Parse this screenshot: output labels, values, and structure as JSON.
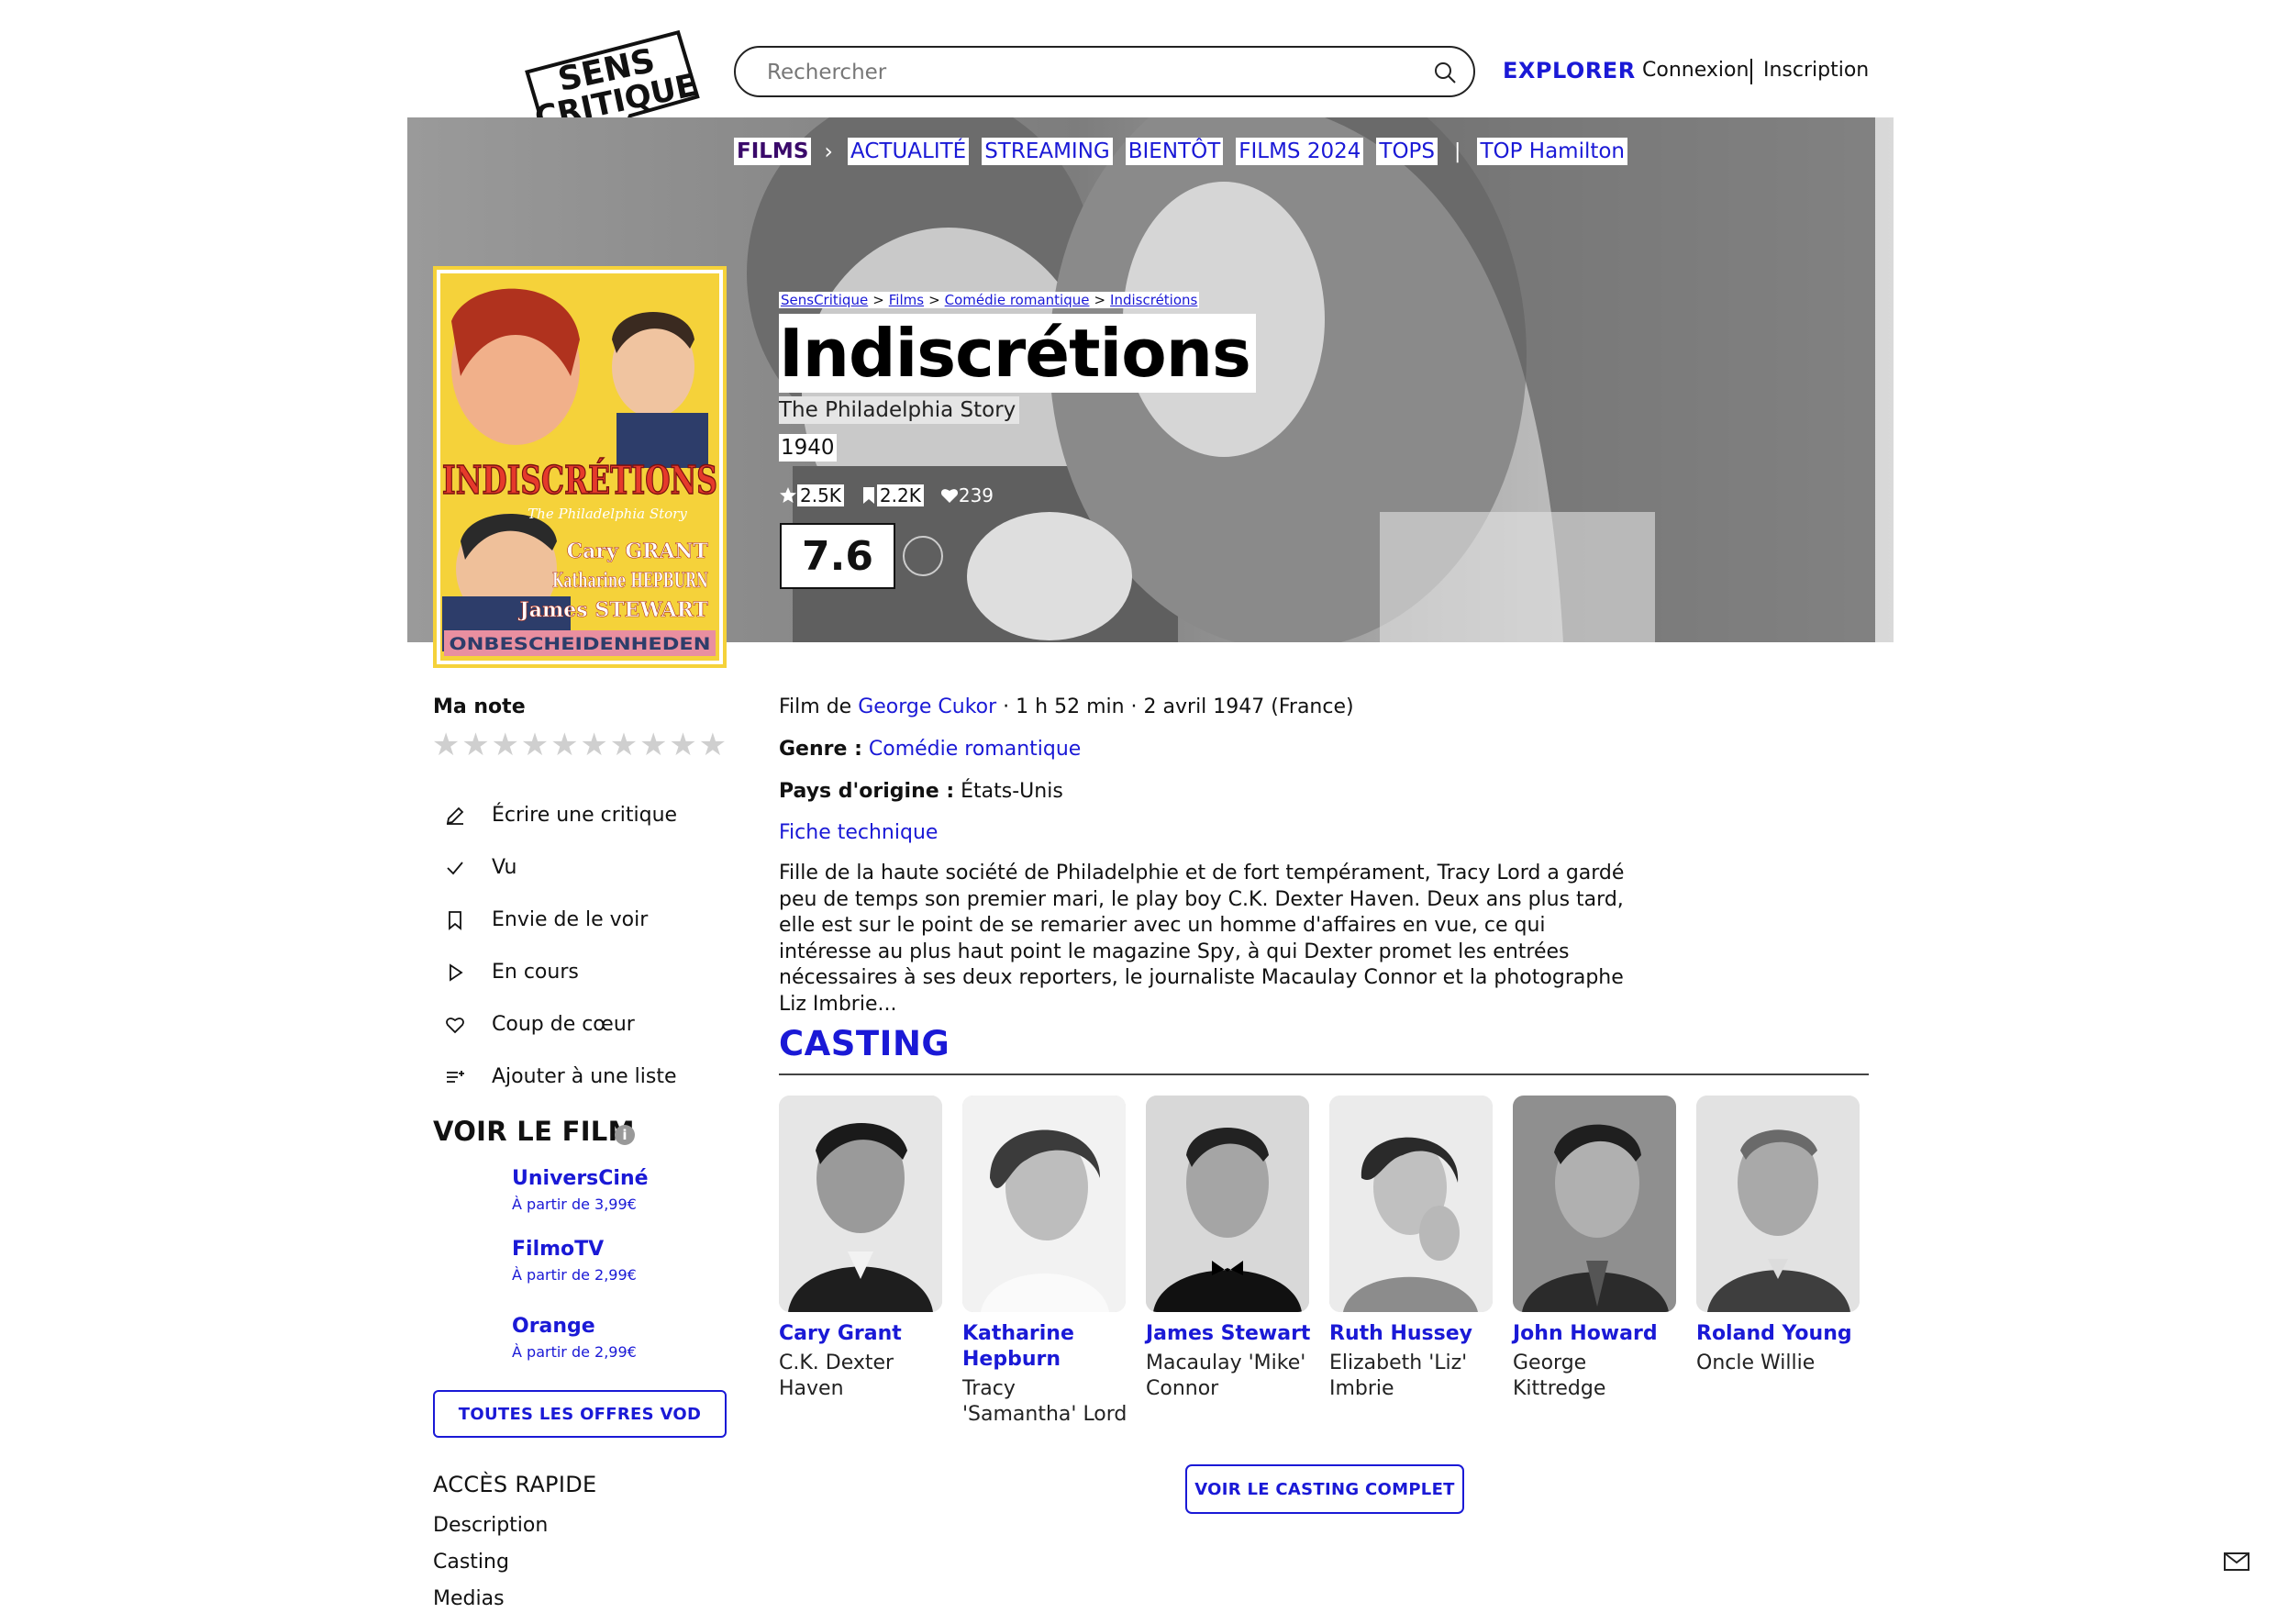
{
  "header": {
    "logo_line1": "SENS",
    "logo_line2": "CRITIQUE",
    "search_placeholder": "Rechercher",
    "explorer": "EXPLORER",
    "login": "Connexion",
    "signup": "Inscription"
  },
  "nav": {
    "films": "FILMS",
    "items": [
      "ACTUALITÉ",
      "STREAMING",
      "BIENTÔT",
      "FILMS 2024",
      "TOPS"
    ],
    "top": "TOP Hamilton"
  },
  "poster": {
    "title": "INDISCRÉTIONS",
    "subtitle": "The Philadelphia Story",
    "actors": [
      "Cary GRANT",
      "Katharine HEPBURN",
      "James STEWART"
    ],
    "banner": "ONBESCHEIDENHEDEN"
  },
  "breadcrumb": [
    "SensCritique",
    "Films",
    "Comédie romantique",
    "Indiscrétions"
  ],
  "movie": {
    "title": "Indiscrétions",
    "original_title": "The Philadelphia Story",
    "year": "1940",
    "stats": {
      "ratings": "2.5K",
      "wishes": "2.2K",
      "likes": "239"
    },
    "score": "7.6",
    "director_prefix": "Film de",
    "director": "George Cukor",
    "meta": "· 1 h 52 min · 2 avril 1947 (France)",
    "genre_label": "Genre :",
    "genre": "Comédie romantique",
    "country_label": "Pays d'origine :",
    "country": "États-Unis",
    "tech_sheet": "Fiche technique",
    "synopsis": "Fille de la haute société de Philadelphie et de fort tempérament, Tracy Lord a gardé peu de temps son premier mari, le play boy C.K. Dexter Haven. Deux ans plus tard, elle est sur le point de se remarier avec un homme d'affaires en vue, ce qui intéresse au plus haut point le magazine Spy, à qui Dexter promet les entrées nécessaires à ses deux reporters, le journaliste Macaulay Connor et la photographe Liz Imbrie..."
  },
  "sidebar": {
    "my_rating": "Ma note",
    "star_count": 10,
    "actions": [
      {
        "icon": "pencil-icon",
        "label": "Écrire une critique"
      },
      {
        "icon": "check-icon",
        "label": "Vu"
      },
      {
        "icon": "bookmark-icon",
        "label": "Envie de le voir"
      },
      {
        "icon": "play-icon",
        "label": "En cours"
      },
      {
        "icon": "heart-icon",
        "label": "Coup de cœur"
      },
      {
        "icon": "add-list-icon",
        "label": "Ajouter à une liste"
      }
    ],
    "watch_title": "VOIR LE FILM",
    "vod": [
      {
        "name": "UniversCiné",
        "price": "À partir de 3,99€"
      },
      {
        "name": "FilmoTV",
        "price": "À partir de 2,99€"
      },
      {
        "name": "Orange",
        "price": "À partir de 2,99€"
      }
    ],
    "all_offers": "TOUTES LES OFFRES VOD",
    "quick_access_title": "ACCÈS RAPIDE",
    "quick_links": [
      "Description",
      "Casting",
      "Medias"
    ]
  },
  "casting": {
    "title": "CASTING",
    "members": [
      {
        "name": "Cary Grant",
        "role": "C.K. Dexter Haven"
      },
      {
        "name": "Katharine Hepburn",
        "role": "Tracy 'Samantha' Lord"
      },
      {
        "name": "James Stewart",
        "role": "Macaulay 'Mike' Connor"
      },
      {
        "name": "Ruth Hussey",
        "role": "Elizabeth 'Liz' Imbrie"
      },
      {
        "name": "John Howard",
        "role": "George Kittredge"
      },
      {
        "name": "Roland Young",
        "role": "Oncle Willie"
      }
    ],
    "full_cast_button": "VOIR LE CASTING COMPLET"
  },
  "colors": {
    "accent": "#1a19d6",
    "films_nav": "#3a0a6a",
    "poster_red": "#e53a2b",
    "poster_yellow": "#f5d23a"
  }
}
